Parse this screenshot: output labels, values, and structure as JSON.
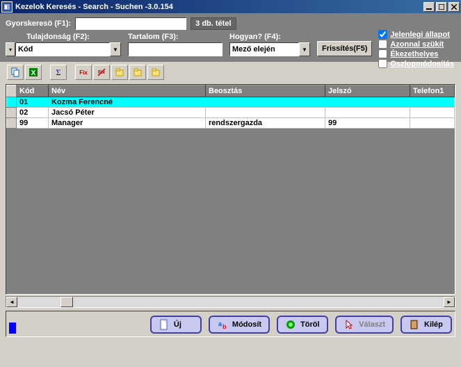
{
  "window": {
    "title": "Kezelok Keresés - Search - Suchen -3.0.154"
  },
  "filter": {
    "quick_label": "Gyorskeresö (F1):",
    "quick_value": "",
    "count_text": "3 db. tétel",
    "tulajdonsag_label": "Tulajdonság (F2):",
    "tulajdonsag_value": "Kód",
    "tartalom_label": "Tartalom (F3):",
    "tartalom_value": "",
    "hogyan_label": "Hogyan? (F4):",
    "hogyan_value": "Mező elején",
    "refresh_label": "Frissítés(F5)"
  },
  "options": {
    "jelenlegi": "Jelenlegi állapot",
    "jelenlegi_checked": true,
    "azonnal": "Azonnal szükít",
    "azonnal_checked": false,
    "ekezet": "Ékezethelyes",
    "ekezet_checked": false,
    "oszlop": "Oszlopmódosítás",
    "oszlop_checked": false
  },
  "grid": {
    "headers": {
      "kod": "Kód",
      "nev": "Név",
      "beosztas": "Beosztás",
      "jelszo": "Jelszó",
      "telefon1": "Telefon1"
    },
    "rows": [
      {
        "kod": "01",
        "nev": "Kozma Ferencné",
        "beosztas": "",
        "jelszo": "",
        "telefon1": "",
        "selected": true
      },
      {
        "kod": "02",
        "nev": "Jacsó Péter",
        "beosztas": "",
        "jelszo": "",
        "telefon1": "",
        "selected": false
      },
      {
        "kod": "99",
        "nev": "Manager",
        "beosztas": "rendszergazda",
        "jelszo": "99",
        "telefon1": "",
        "selected": false
      }
    ]
  },
  "buttons": {
    "uj": "Új",
    "modosit": "Módosít",
    "torol": "Töröl",
    "valaszt": "Választ",
    "kilep": "Kilép"
  }
}
